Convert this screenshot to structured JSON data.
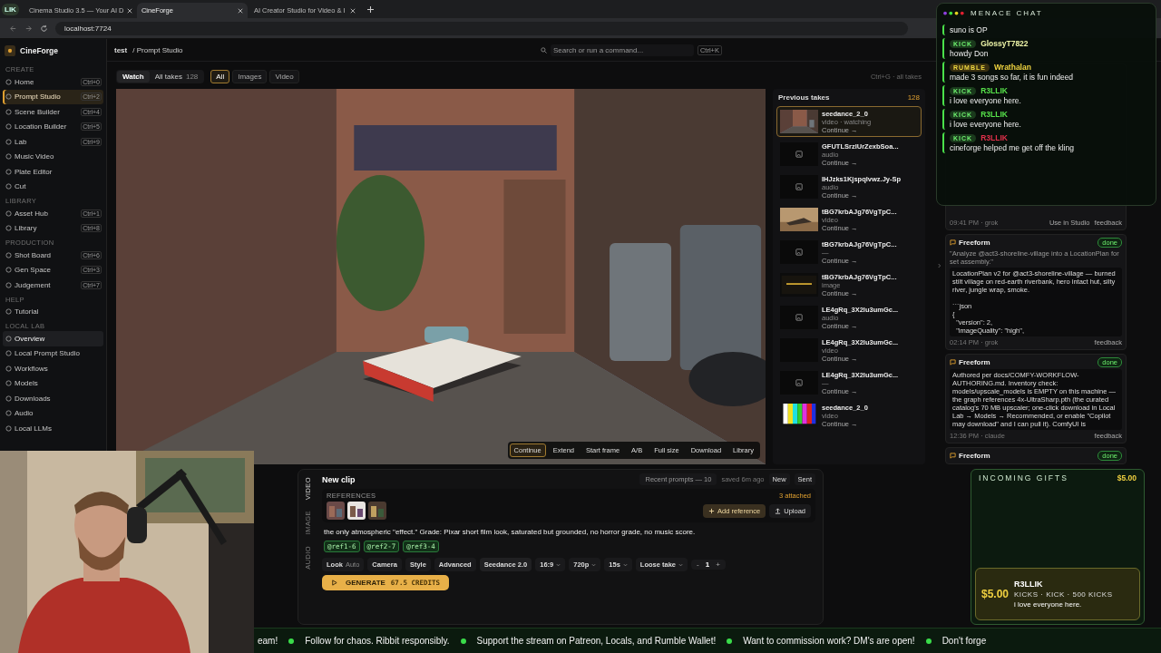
{
  "browser": {
    "profile_chip": "LIK",
    "tabs": [
      {
        "title": "Cinema Studio 3.5 — Your AI D",
        "selected": false
      },
      {
        "title": "CineForge",
        "selected": true
      },
      {
        "title": "AI Creator Studio for Video & I",
        "selected": false
      }
    ],
    "address": "localhost:7724"
  },
  "app": {
    "brand": "CineForge",
    "breadcrumb": {
      "project": "test",
      "page": "/ Prompt Studio"
    },
    "command": {
      "placeholder": "Search or run a command...",
      "shortcut": "Ctrl+K"
    },
    "sidebar": {
      "sections": [
        {
          "heading": "CREATE",
          "items": [
            {
              "label": "Home",
              "shortcut": "Ctrl+0",
              "selected": false,
              "hovered": false
            },
            {
              "label": "Prompt Studio",
              "shortcut": "Ctrl+2",
              "selected": true,
              "hovered": false
            },
            {
              "label": "Scene Builder",
              "shortcut": "Ctrl+4",
              "selected": false,
              "hovered": false
            },
            {
              "label": "Location Builder",
              "shortcut": "Ctrl+5",
              "selected": false,
              "hovered": false
            },
            {
              "label": "Lab",
              "shortcut": "Ctrl+9",
              "selected": false,
              "hovered": false
            },
            {
              "label": "Music Video",
              "selected": false,
              "hovered": false
            },
            {
              "label": "Plate Editor",
              "selected": false,
              "hovered": false
            },
            {
              "label": "Cut",
              "selected": false,
              "hovered": false
            }
          ]
        },
        {
          "heading": "LIBRARY",
          "items": [
            {
              "label": "Asset Hub",
              "shortcut": "Ctrl+1",
              "selected": false,
              "hovered": false
            },
            {
              "label": "Library",
              "shortcut": "Ctrl+8",
              "selected": false,
              "hovered": false
            }
          ]
        },
        {
          "heading": "PRODUCTION",
          "items": [
            {
              "label": "Shot Board",
              "shortcut": "Ctrl+6",
              "selected": false,
              "hovered": false
            },
            {
              "label": "Gen Space",
              "shortcut": "Ctrl+3",
              "selected": false,
              "hovered": false
            },
            {
              "label": "Judgement",
              "shortcut": "Ctrl+7",
              "selected": false,
              "hovered": false
            }
          ]
        },
        {
          "heading": "HELP",
          "items": [
            {
              "label": "Tutorial",
              "selected": false,
              "hovered": false
            }
          ]
        },
        {
          "heading": "LOCAL LAB",
          "items": [
            {
              "label": "Overview",
              "selected": false,
              "hovered": true
            },
            {
              "label": "Local Prompt Studio",
              "selected": false,
              "hovered": false
            },
            {
              "label": "Workflows",
              "selected": false,
              "hovered": false
            },
            {
              "label": "Models",
              "selected": false,
              "hovered": false
            },
            {
              "label": "Downloads",
              "selected": false,
              "hovered": false
            },
            {
              "label": "Audio",
              "selected": false,
              "hovered": false
            },
            {
              "label": "Local LLMs",
              "selected": false,
              "hovered": false
            }
          ]
        }
      ]
    },
    "view_modes": [
      {
        "label": "Watch",
        "selected": true
      },
      {
        "label": "All takes",
        "count": "128",
        "selected": false
      }
    ],
    "filters": [
      {
        "label": "All",
        "selected": true
      },
      {
        "label": "Images",
        "selected": false
      },
      {
        "label": "Video",
        "selected": false
      }
    ],
    "toolbar_hint": "Ctrl+G · all takes",
    "player": {
      "kind": "picture",
      "controls": [
        {
          "label": "Continue",
          "selected": true
        },
        {
          "label": "Extend",
          "selected": false
        },
        {
          "label": "Start frame",
          "selected": false
        },
        {
          "label": "A/B",
          "selected": false
        },
        {
          "label": "Full size",
          "selected": false
        },
        {
          "label": "Download",
          "selected": false
        },
        {
          "label": "Library",
          "selected": false
        }
      ]
    },
    "takes": {
      "title": "Previous takes",
      "count": "128",
      "items": [
        {
          "name": "seedance_2_0",
          "type": "video · watching",
          "action": "Continue →",
          "thumb": {
            "kind": "alley"
          },
          "selected": true
        },
        {
          "name": "GFUTLSrzlUrZexbSoa...",
          "type": "audio",
          "action": "Continue →",
          "thumb": {
            "kind": "icon"
          },
          "selected": false
        },
        {
          "name": "IHJzks1Kjspqlvwz.Jy-Sp",
          "type": "audio",
          "action": "Continue →",
          "thumb": {
            "kind": "icon"
          },
          "selected": false
        },
        {
          "name": "tBG7krbAJg76VgTpC...",
          "type": "video",
          "action": "Continue →",
          "thumb": {
            "kind": "desert"
          },
          "selected": false
        },
        {
          "name": "tBG7krbAJg76VgTpC...",
          "type": "—",
          "action": "Continue →",
          "thumb": {
            "kind": "icon"
          },
          "selected": false
        },
        {
          "name": "tBG7krbAJg76VgTpC...",
          "type": "image",
          "action": "Continue →",
          "thumb": {
            "kind": "card"
          },
          "selected": false
        },
        {
          "name": "LE4gRq_3X2lu3umGc...",
          "type": "audio",
          "action": "Continue →",
          "thumb": {
            "kind": "icon"
          },
          "selected": false
        },
        {
          "name": "LE4gRq_3X2lu3umGc...",
          "type": "video",
          "action": "Continue →",
          "thumb": {
            "kind": "dark"
          },
          "selected": false
        },
        {
          "name": "LE4gRq_3X2lu3umGc...",
          "type": "—",
          "action": "Continue →",
          "thumb": {
            "kind": "icon"
          },
          "selected": false
        },
        {
          "name": "seedance_2_0",
          "type": "video",
          "action": "Continue →",
          "thumb": {
            "kind": "bars"
          },
          "selected": false
        }
      ]
    },
    "composer": {
      "side_tabs": [
        {
          "label": "VIDEO",
          "selected": true
        },
        {
          "label": "IMAGE",
          "selected": false
        },
        {
          "label": "AUDIO",
          "selected": false
        }
      ],
      "title": "New clip",
      "recent": "Recent prompts — 10",
      "saved": "saved 6m ago",
      "actions": [
        "New",
        "Sent"
      ],
      "references": {
        "label": "REFERENCES",
        "attached": "3 attached",
        "thumbs": [
          {
            "kind": "picture"
          },
          {
            "kind": "picture"
          },
          {
            "kind": "picture"
          }
        ],
        "add": "Add reference",
        "upload": "Upload"
      },
      "prompt": "the only atmospheric \"effect.\" Grade: Pixar short film look, saturated but grounded, no horror grade, no music score.",
      "chips": [
        "@ref1-6",
        "@ref2-7",
        "@ref3-4"
      ],
      "options": [
        {
          "kind": "button",
          "label": "Look",
          "value": "Auto"
        },
        {
          "kind": "button",
          "label": "Camera"
        },
        {
          "kind": "button",
          "label": "Style"
        },
        {
          "kind": "button",
          "label": "Advanced"
        },
        {
          "kind": "model",
          "label": "Seedance 2.0"
        },
        {
          "kind": "select",
          "label": "16:9"
        },
        {
          "kind": "select",
          "label": "720p"
        },
        {
          "kind": "select",
          "label": "15s"
        },
        {
          "kind": "select",
          "label": "Loose take"
        }
      ],
      "stepper": {
        "minus": "-",
        "value": "1",
        "plus": "+"
      },
      "generate": {
        "label": "GENERATE",
        "credits": "67.5 CREDITS"
      }
    },
    "copilot": {
      "first_card_footer": {
        "time": "09:41 PM · grok",
        "actions": [
          "Use in Studio",
          "feedback"
        ]
      },
      "cards": [
        {
          "title": "Freeform",
          "status": "done",
          "prompt": "\"Analyze @act3-shoreline-village into a LocationPlan for set assembly.\"",
          "body": "LocationPlan v2 for @act3-shoreline-village — burned stilt village on red-earth riverbank, hero intact hut, silty river, jungle wrap, smoke.\n\n```json\n{\n  \"version\": 2,\n  \"imageQuality\": \"high\",",
          "time": "02:14 PM · grok",
          "actions": [
            "feedback"
          ]
        },
        {
          "title": "Freeform",
          "status": "done",
          "body": "Authored per docs/COMFY-WORKFLOW-AUTHORING.md. Inventory check: models/upscale_models is EMPTY on this machine — the graph references 4x-UltraSharp.pth (the curated catalog's 70 MB upscaler; one-click download in Local Lab → Models → Recommended, or enable \"Copilot may download\" and I can pull it). ComfyUI is",
          "time": "12:36 PM · claude",
          "actions": [
            "feedback"
          ]
        },
        {
          "title": "Freeform",
          "status": "done"
        }
      ]
    }
  },
  "stream": {
    "chat": {
      "title": "MENACE CHAT",
      "messages": [
        {
          "text": "suno is OP"
        },
        {
          "platform": "KICK",
          "user": "GlossyT7822",
          "color": "#eef5a8",
          "text": "howdy Don"
        },
        {
          "platform": "RUMBLE",
          "user": "Wrathalan",
          "color": "#f0d440",
          "text": "made 3 songs so far, it is fun indeed"
        },
        {
          "platform": "KICK",
          "user": "R3LLIK",
          "color": "#56e04a",
          "text": "i love everyone here."
        },
        {
          "platform": "KICK",
          "user": "R3LLIK",
          "color": "#56e04a",
          "text": "i love everyone here."
        },
        {
          "platform": "KICK",
          "user": "R3LLIK",
          "color": "#e0304a",
          "text": "cineforge helped me get off the kling"
        }
      ]
    },
    "webcam": {
      "kind": "picture"
    },
    "gifts": {
      "title": "INCOMING GIFTS",
      "amount": "$5.00"
    },
    "alert": {
      "amount": "$5.00",
      "user": "R3LLIK",
      "detail": "KICKS · KICK · 500 KICKS",
      "message": "i love everyone here."
    },
    "ticker": [
      "eam!",
      "Follow for chaos. Ribbit responsibly.",
      "Support the stream on Patreon, Locals, and Rumble Wallet!",
      "Want to commission work? DM's are open!",
      "Don't forge"
    ]
  }
}
